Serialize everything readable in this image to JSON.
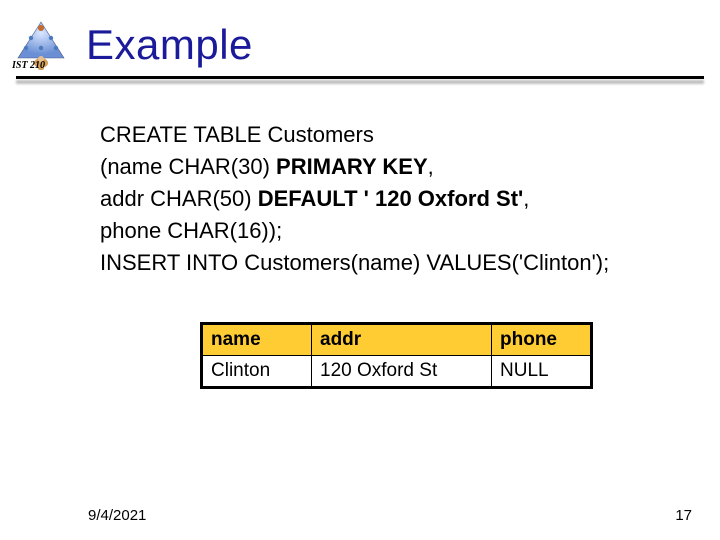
{
  "header": {
    "course_code": "IST 210",
    "title": "Example"
  },
  "sql": {
    "line1": "CREATE TABLE Customers",
    "line2_a": "(name CHAR(30) ",
    "line2_b": "PRIMARY KEY",
    "line2_c": ",",
    "line3_a": "addr CHAR(50) ",
    "line3_b": "DEFAULT ' 120 Oxford St'",
    "line3_c": ",",
    "line4": "phone CHAR(16));",
    "line5": "INSERT INTO Customers(name) VALUES('Clinton');"
  },
  "table": {
    "headers": {
      "name": "name",
      "addr": "addr",
      "phone": "phone"
    },
    "rows": [
      {
        "name": "Clinton",
        "addr": "120 Oxford St",
        "phone": "NULL"
      }
    ]
  },
  "footer": {
    "date": "9/4/2021",
    "page": "17"
  }
}
